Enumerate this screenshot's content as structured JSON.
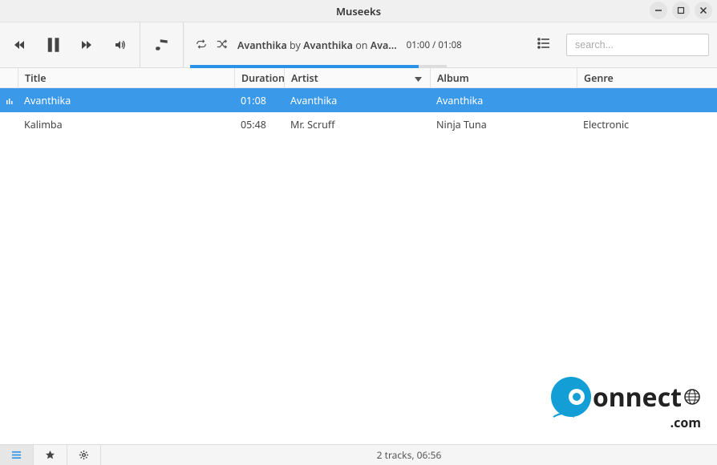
{
  "app": {
    "title": "Museeks"
  },
  "player": {
    "repeat": "repeat",
    "shuffle": "shuffle",
    "now_playing": {
      "track": "Avanthika",
      "by": "by",
      "artist": "Avanthika",
      "on": "on",
      "album_trunc": "Ava..."
    },
    "time_current": "01:00",
    "time_sep": " / ",
    "time_total": "01:08",
    "progress_percent": 89
  },
  "search": {
    "placeholder": "search..."
  },
  "columns": {
    "title": "Title",
    "duration": "Duration",
    "artist": "Artist",
    "album": "Album",
    "genre": "Genre"
  },
  "tracks": [
    {
      "playing": true,
      "title": "Avanthika",
      "duration": "01:08",
      "artist": "Avanthika",
      "album": "Avanthika",
      "genre": ""
    },
    {
      "playing": false,
      "title": "Kalimba",
      "duration": "05:48",
      "artist": "Mr. Scruff",
      "album": "Ninja Tuna",
      "genre": "Electronic"
    }
  ],
  "footer": {
    "status": "2 tracks, 06:56"
  },
  "watermark": {
    "text1": "onnect",
    "text2": ".com"
  }
}
